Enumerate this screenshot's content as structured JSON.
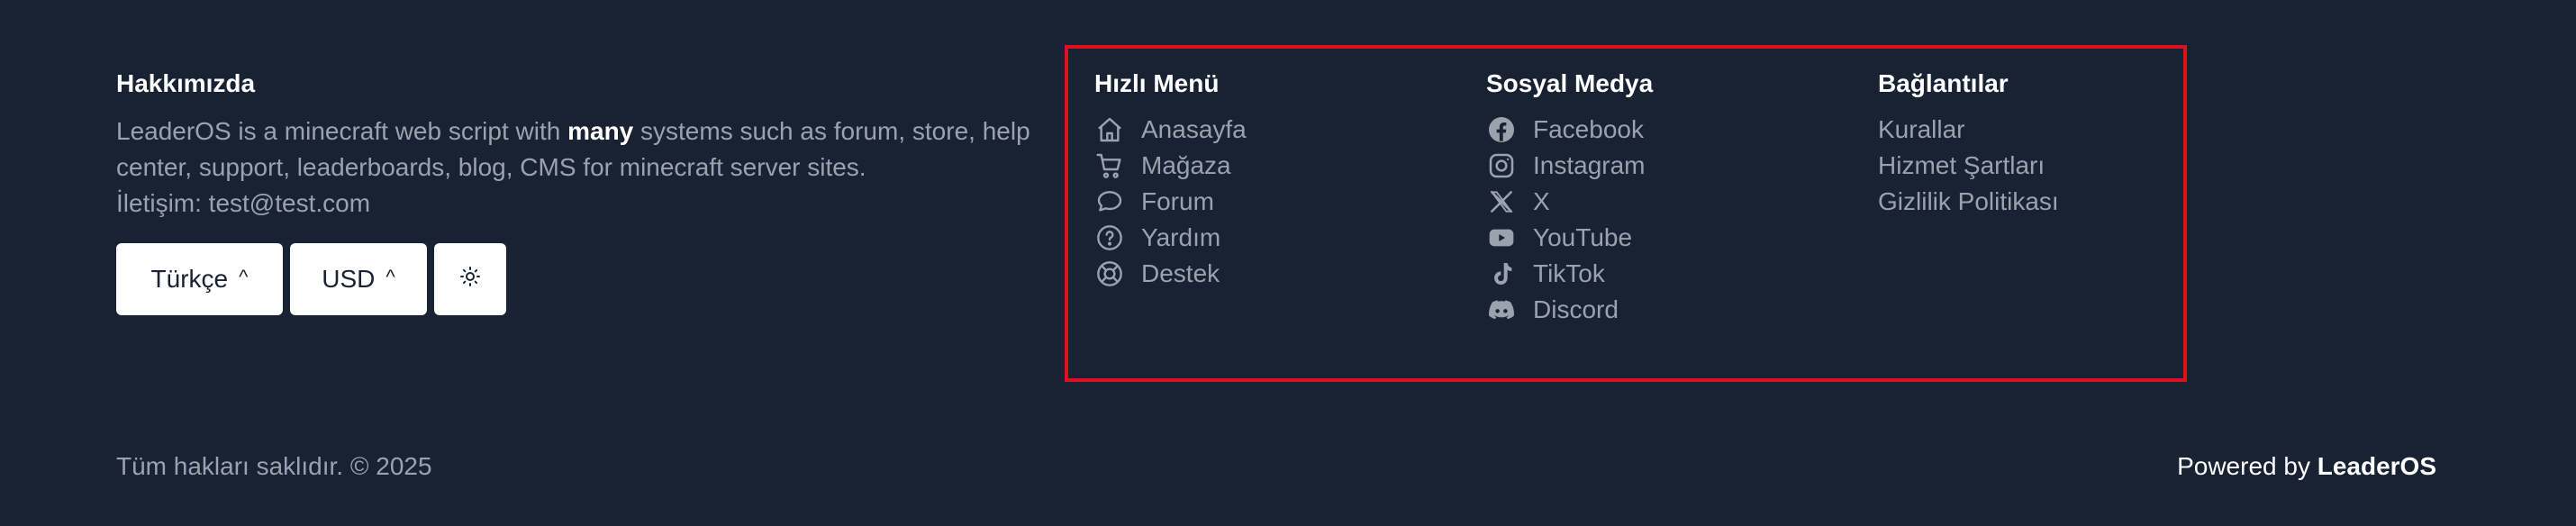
{
  "about": {
    "title": "Hakkımızda",
    "text_part1": "LeaderOS is a minecraft web script with ",
    "text_bold": "many",
    "text_part2": " systems such as forum, store, help center, support, leaderboards, blog, CMS for minecraft server sites.",
    "contact": "İletişim: test@test.com"
  },
  "controls": {
    "language": "Türkçe",
    "currency": "USD",
    "caret": "^",
    "theme_icon": "sun-icon"
  },
  "quick_menu": {
    "title": "Hızlı Menü",
    "items": [
      {
        "label": "Anasayfa",
        "icon": "home-icon"
      },
      {
        "label": "Mağaza",
        "icon": "cart-icon"
      },
      {
        "label": "Forum",
        "icon": "chat-icon"
      },
      {
        "label": "Yardım",
        "icon": "help-icon"
      },
      {
        "label": "Destek",
        "icon": "lifebuoy-icon"
      }
    ]
  },
  "social": {
    "title": "Sosyal Medya",
    "items": [
      {
        "label": "Facebook",
        "icon": "facebook-icon"
      },
      {
        "label": "Instagram",
        "icon": "instagram-icon"
      },
      {
        "label": "X",
        "icon": "x-icon"
      },
      {
        "label": "YouTube",
        "icon": "youtube-icon"
      },
      {
        "label": "TikTok",
        "icon": "tiktok-icon"
      },
      {
        "label": "Discord",
        "icon": "discord-icon"
      }
    ]
  },
  "links": {
    "title": "Bağlantılar",
    "items": [
      {
        "label": "Kurallar"
      },
      {
        "label": "Hizmet Şartları"
      },
      {
        "label": "Gizlilik Politikası"
      }
    ]
  },
  "footer": {
    "copyright": "Tüm hakları saklıdır. © 2025",
    "powered_prefix": "Powered by ",
    "powered_brand": "LeaderOS"
  },
  "colors": {
    "background": "#182233",
    "muted_text": "#9aa2ae",
    "heading_text": "#ffffff",
    "highlight_border": "#e0111c"
  }
}
